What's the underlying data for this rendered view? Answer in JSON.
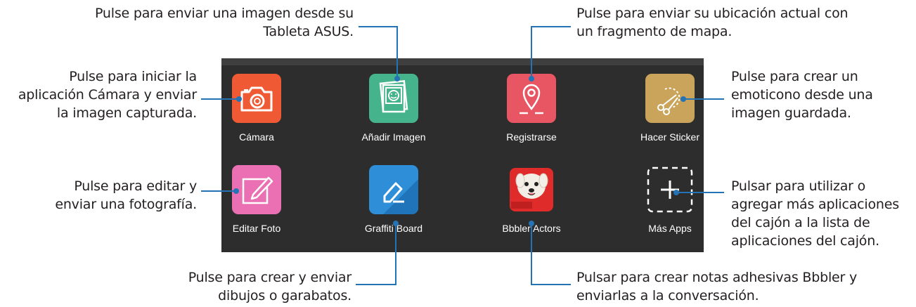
{
  "callouts": {
    "enviar_imagen": "Pulse para enviar una imagen desde su\nTableta ASUS.",
    "ubicacion": "Pulse para enviar su ubicación actual con\nun fragmento de mapa.",
    "camara": "Pulse para iniciar la\naplicación Cámara y enviar\nla imagen capturada.",
    "sticker": "Pulse para crear un\nemoticono desde una\nimagen guardada.",
    "editar": "Pulse para editar y\nenviar una fotografía.",
    "mas_apps": "Pulsar para utilizar o\nagregar más aplicaciones\ndel cajón a la lista de\naplicaciones del cajón.",
    "graffiti": "Pulse para crear y enviar\ndibujos o garabatos.",
    "bbbler": "Pulsar para crear notas adhesivas Bbbler y\nenviarlas a la conversación."
  },
  "apps": [
    {
      "label": "Cámara",
      "icon": "camera-icon",
      "color": "#ef5a35"
    },
    {
      "label": "Añadir Imagen",
      "icon": "picture-icon",
      "color": "#45b38c"
    },
    {
      "label": "Registrarse",
      "icon": "location-pin-icon",
      "color": "#e85563"
    },
    {
      "label": "Hacer Sticker",
      "icon": "scissors-icon",
      "color": "#c9a45a"
    },
    {
      "label": "Editar Foto",
      "icon": "pencil-icon",
      "color": "#ea6fb3"
    },
    {
      "label": "Graffiti Board",
      "icon": "eraser-icon",
      "color": "#2e8ed8"
    },
    {
      "label": "Bbbler Actors",
      "icon": "bbbler-dog-icon",
      "color": "#e02b2b"
    },
    {
      "label": "Más Apps",
      "icon": "plus-icon",
      "color": "#2d2d2d"
    }
  ],
  "colors": {
    "panel_bg": "#2d2d2d",
    "leader_line": "#2473b5"
  }
}
